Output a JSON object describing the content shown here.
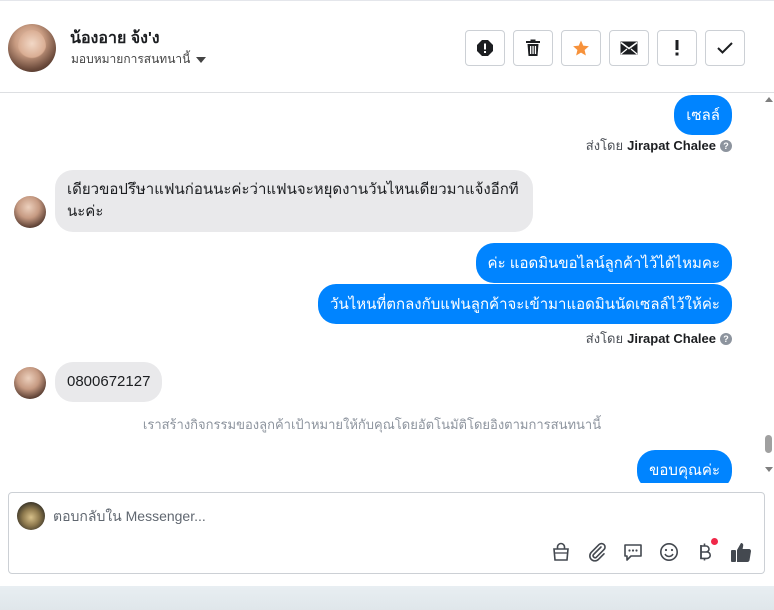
{
  "header": {
    "name": "น้องอาย จ้ง'ง",
    "assign_label": "มอบหมายการสนทนานี้",
    "actions": [
      {
        "name": "spam-icon",
        "label": "!"
      },
      {
        "name": "trash-icon",
        "label": ""
      },
      {
        "name": "star-icon",
        "label": ""
      },
      {
        "name": "mail-icon",
        "label": ""
      },
      {
        "name": "follow-up-icon",
        "label": "!"
      },
      {
        "name": "check-icon",
        "label": ""
      }
    ],
    "accent_star": "#f7923b"
  },
  "messages": {
    "m1": "เซลล์",
    "sent_by_prefix": "ส่งโดย",
    "sent_by_name": "Jirapat Chalee",
    "m2_line1": "เดียวขอปรึษาแฟนก่อนนะค่ะว่าแฟนจะหยุดงานวันไหนเดียวมาแจ้งอีกที",
    "m2_line2": "นะค่ะ",
    "m3": "ค่ะ แอดมินขอไลน์ลูกค้าไว้ได้ไหมคะ",
    "m4": "วันไหนที่ตกลงกับแฟนลูกค้าจะเข้ามาแอดมินนัดเซลล์ไว้ให้ค่ะ",
    "m5": "0800672127",
    "system_note": "เราสร้างกิจกรรมของลูกค้าเป้าหมายให้กับคุณโดยอัตโนมัติโดยอิงตามการสนทนานี้",
    "m6": "ขอบคุณค่ะ"
  },
  "composer": {
    "placeholder": "ตอบกลับใน Messenger..."
  },
  "colors": {
    "outgoing_bubble": "#0084ff",
    "incoming_bubble": "#e9e9eb",
    "notify_dot": "#f02849"
  }
}
